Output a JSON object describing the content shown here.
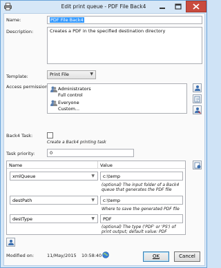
{
  "window": {
    "title": "Edit print queue - PDF File Back4",
    "controls": {
      "minimize": "minimize-icon",
      "maximize": "maximize-icon",
      "close": "close-icon"
    }
  },
  "form": {
    "name_label": "Name:",
    "name_value": "PDF File Back4",
    "description_label": "Description:",
    "description_value": "Creates a PDF in the specified destination directory",
    "template_label": "Template:",
    "template_value": "Print File",
    "access_label": "Access permissions:",
    "permissions": [
      {
        "principal": "Administrators",
        "right": "Full control"
      },
      {
        "principal": "Everyone",
        "right": "Custom..."
      }
    ],
    "back4_label": "Back4 Task:",
    "back4_checked": false,
    "back4_hint": "Create a Back4 printing task",
    "priority_label": "Task priority:",
    "priority_value": "0"
  },
  "params": {
    "col_name": "Name",
    "col_value": "Value",
    "rows": [
      {
        "name": "xmlQueue",
        "value": "c:\\temp",
        "hint": "(optional) The input folder of a Back4 queue that generates the PDF file"
      },
      {
        "name": "destPath",
        "value": "c:\\temp",
        "hint": "Where to save the generated PDF file"
      },
      {
        "name": "destType",
        "value": "PDF",
        "hint": "(optional) The type ('PDF' or 'PS') of print output; default value: PDF"
      }
    ]
  },
  "footer": {
    "modified_label": "Modified on:",
    "modified_date": "11/May/2015",
    "modified_time": "10:58:40",
    "ok_label": "OK",
    "cancel_label": "Cancel"
  },
  "colors": {
    "accent": "#3399ff",
    "window_border": "#6aa3d8",
    "close": "#c94b3e"
  }
}
